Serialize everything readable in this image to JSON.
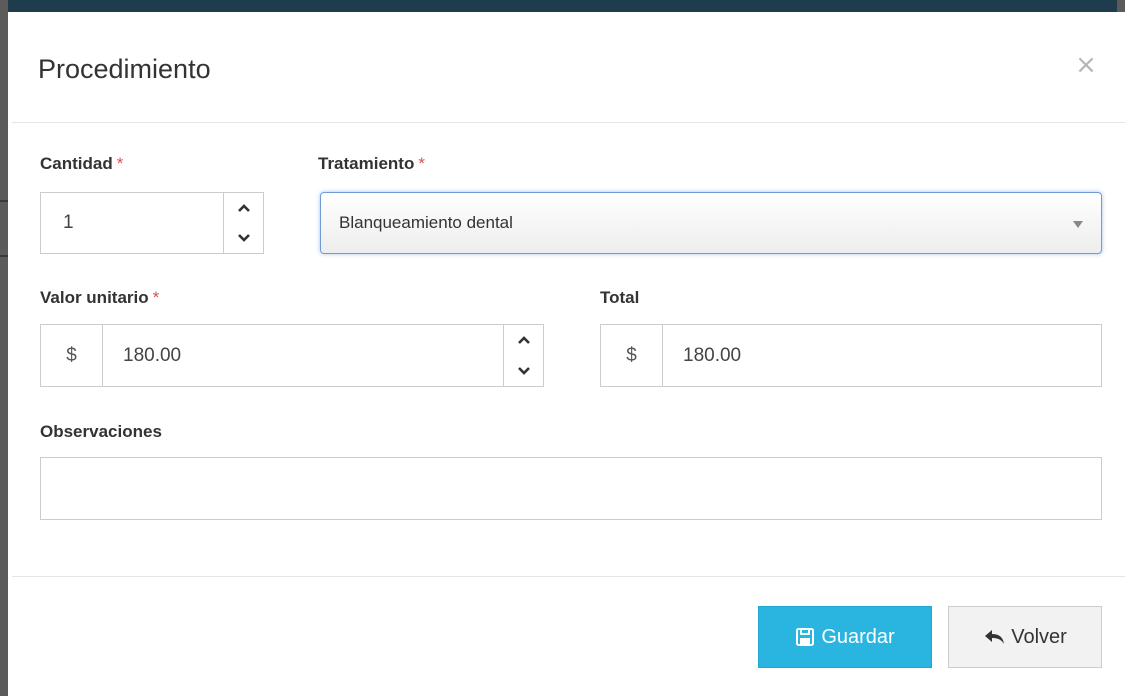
{
  "modal": {
    "title": "Procedimiento",
    "close_symbol": "×",
    "required_marker": "*"
  },
  "fields": {
    "cantidad": {
      "label": "Cantidad",
      "value": "1",
      "required": true
    },
    "tratamiento": {
      "label": "Tratamiento",
      "value": "Blanqueamiento dental",
      "required": true
    },
    "valor_unitario": {
      "label": "Valor unitario",
      "currency": "$",
      "value": "180.00",
      "required": true
    },
    "total": {
      "label": "Total",
      "currency": "$",
      "value": "180.00",
      "required": false
    },
    "observaciones": {
      "label": "Observaciones",
      "value": ""
    }
  },
  "buttons": {
    "guardar": {
      "label": "Guardar",
      "icon": "floppy-disk-icon",
      "color": "#2ab5e0"
    },
    "volver": {
      "label": "Volver",
      "icon": "reply-arrow-icon"
    }
  },
  "colors": {
    "required": "#d9534f",
    "primary": "#2ab5e0",
    "topbar": "#1f3c4d"
  }
}
